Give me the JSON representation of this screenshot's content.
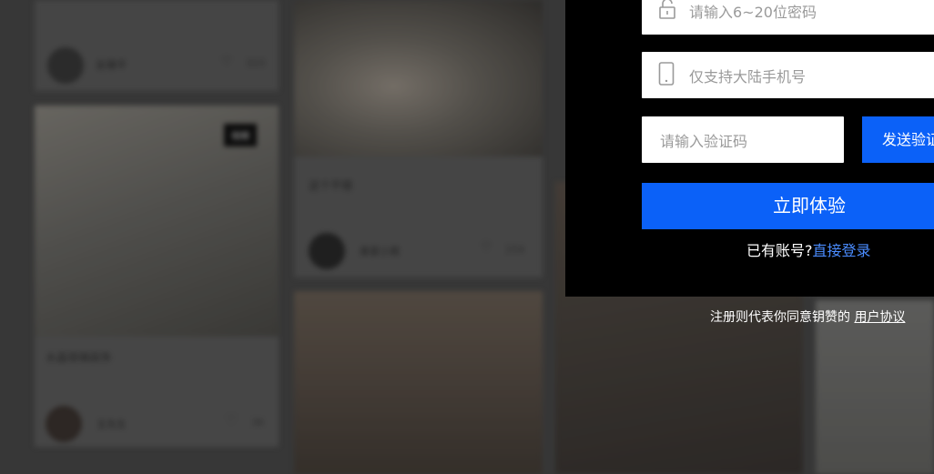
{
  "feed": {
    "cards": [
      {
        "author": "赵雅平",
        "likes": "323"
      },
      {
        "caption": "水晶琅璃装饰",
        "badge": "视频",
        "author": "王先生",
        "likes": "36"
      },
      {
        "caption": "这个不错",
        "author": "美家小窝",
        "likes": "154"
      }
    ]
  },
  "register": {
    "password_placeholder": "请输入6~20位密码",
    "phone_placeholder": "仅支持大陆手机号",
    "code_placeholder": "请输入验证码",
    "send_code_label": "发送验证",
    "submit_label": "立即体验",
    "have_account_text": "已有账号?",
    "login_link": "直接登录",
    "agreement_text": "注册则代表你同意钥赞的",
    "agreement_link": "用户协议"
  },
  "colors": {
    "accent": "#0b61f8",
    "panel": "#000000",
    "link": "#4a8cff"
  }
}
